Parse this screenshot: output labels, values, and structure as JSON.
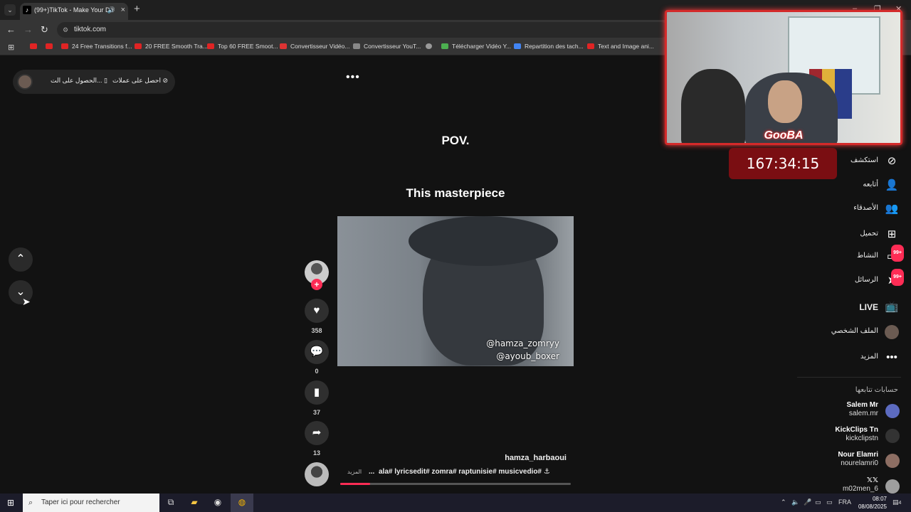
{
  "browser": {
    "tab_title": "(99+)TikTok - Make Your Da",
    "url": "tiktok.com",
    "bookmarks": [
      {
        "label": "24 Free Transitions f...",
        "icon": "youtube"
      },
      {
        "label": "20 FREE Smooth Tra...",
        "icon": "youtube"
      },
      {
        "label": "Top 60 FREE Smoot...",
        "icon": "youtube"
      },
      {
        "label": "Convertisseur Vidéo...",
        "icon": "z"
      },
      {
        "label": "Convertisseur YouT...",
        "icon": "generic"
      },
      {
        "label": "Télécharger Vidéo Y...",
        "icon": "download"
      },
      {
        "label": "Repartition des tach...",
        "icon": "doc"
      },
      {
        "label": "Text and Image ani...",
        "icon": "youtube"
      }
    ]
  },
  "topbar": {
    "get_app_label": "الحصول على الت...",
    "get_coins_label": "احصل على عملات"
  },
  "video": {
    "caption_top": "POV.",
    "caption_main": "This masterpiece",
    "overlay_tag_1": "@hamza_zomryy",
    "overlay_tag_2": "@ayoub_boxer",
    "author": "hamza_harbaoui",
    "hashtags": "ala# lyricsedit# zomra# raptunisie# musicvedio# ⚓",
    "more_label": "المزيد",
    "ellipsis": "...",
    "progress": 0.13
  },
  "actions": {
    "likes": "358",
    "comments": "0",
    "saves": "37",
    "shares": "13"
  },
  "sidebar": {
    "items": [
      {
        "label": "استكشف",
        "icon": "compass-icon",
        "badge": ""
      },
      {
        "label": "أتابعه",
        "icon": "follow-icon",
        "badge": ""
      },
      {
        "label": "الأصدقاء",
        "icon": "friends-icon",
        "badge": ""
      },
      {
        "label": "تحميل",
        "icon": "upload-icon",
        "badge": ""
      },
      {
        "label": "النشاط",
        "icon": "activity-icon",
        "badge": "99+"
      },
      {
        "label": "الرسائل",
        "icon": "messages-icon",
        "badge": "99+"
      },
      {
        "label": "LIVE",
        "icon": "live-icon",
        "badge": ""
      },
      {
        "label": "الملف الشخصي",
        "icon": "profile-avatar",
        "badge": ""
      },
      {
        "label": "المزيد",
        "icon": "more-icon",
        "badge": ""
      }
    ],
    "following_title": "حسابات تتابعها",
    "accounts": [
      {
        "name": "Salem Mr",
        "handle": "salem.mr"
      },
      {
        "name": "KickClips Tn",
        "handle": "kickclipstn"
      },
      {
        "name": "Nour Elamri",
        "handle": "nourelamri0"
      },
      {
        "name": "𝕏𝕏",
        "handle": "m02men_6"
      }
    ]
  },
  "stream_overlay": {
    "brand": "GooBA",
    "timer": "167:34:15"
  },
  "taskbar": {
    "search_placeholder": "Taper ici pour rechercher",
    "language": "FRA",
    "time": "08:07",
    "date": "08/08/2025",
    "notifications": "4"
  },
  "colors": {
    "accent": "#fe2c55",
    "background": "#121212",
    "timer_bg": "#7a0e12"
  }
}
